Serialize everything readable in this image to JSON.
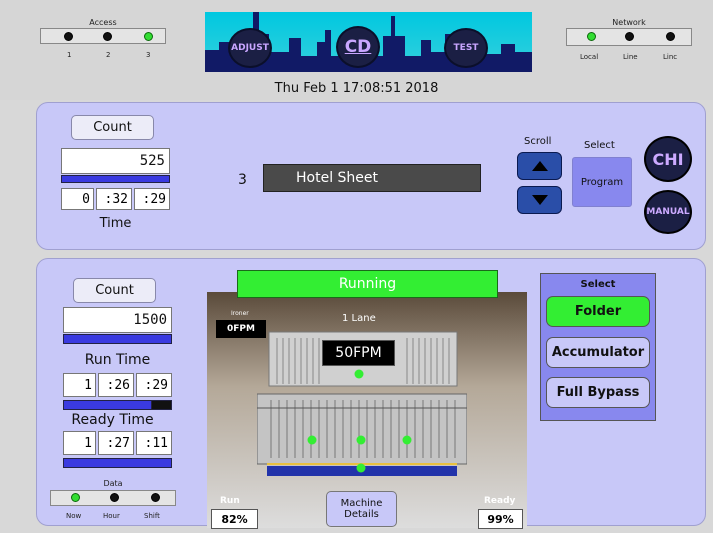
{
  "header": {
    "access": {
      "title": "Access",
      "labels": [
        "1",
        "2",
        "3"
      ],
      "states": [
        "off",
        "off",
        "on"
      ]
    },
    "network": {
      "title": "Network",
      "labels": [
        "Local",
        "Line",
        "Linc"
      ],
      "states": [
        "on",
        "off",
        "off"
      ]
    },
    "nav": {
      "adjust": "ADJUST",
      "cd": "CD",
      "test": "TEST"
    },
    "datetime": "Thu Feb  1 17:08:51 2018"
  },
  "program_panel": {
    "count_label": "Count",
    "count_value": "525",
    "count_progress": 1.0,
    "time": [
      "0",
      ":32",
      ":29"
    ],
    "time_label": "Time",
    "program_number": "3",
    "program_name": "Hotel Sheet",
    "scroll_label": "Scroll",
    "select_label": "Select",
    "program_button": "Program",
    "chi_button": "CHI",
    "manual_button": "MANUAL"
  },
  "machine_panel": {
    "count_label": "Count",
    "count_value": "1500",
    "count_progress": 1.0,
    "run_time_label": "Run Time",
    "run_time": [
      "1",
      ":26",
      ":29"
    ],
    "run_time_progress": 0.82,
    "ready_time_label": "Ready Time",
    "ready_time": [
      "1",
      ":27",
      ":11"
    ],
    "ready_time_progress": 1.0,
    "data": {
      "title": "Data",
      "labels": [
        "Now",
        "Hour",
        "Shift"
      ],
      "states": [
        "on",
        "off",
        "off"
      ]
    },
    "status": "Running",
    "ironer_label": "Ironer",
    "ironer_speed": "0FPM",
    "lane_label": "1 Lane",
    "speed": "50FPM",
    "run_label": "Run",
    "run_pct": "82%",
    "ready_label": "Ready",
    "ready_pct": "99%",
    "machine_details": "Machine Details",
    "select_title": "Select",
    "modes": [
      "Folder",
      "Accumulator",
      "Full Bypass"
    ],
    "active_mode": "Folder"
  },
  "colors": {
    "panel": "#c8c8f8",
    "active": "#33ee33",
    "bar": "#3a3ae0",
    "skyline": "#00c8e0"
  }
}
